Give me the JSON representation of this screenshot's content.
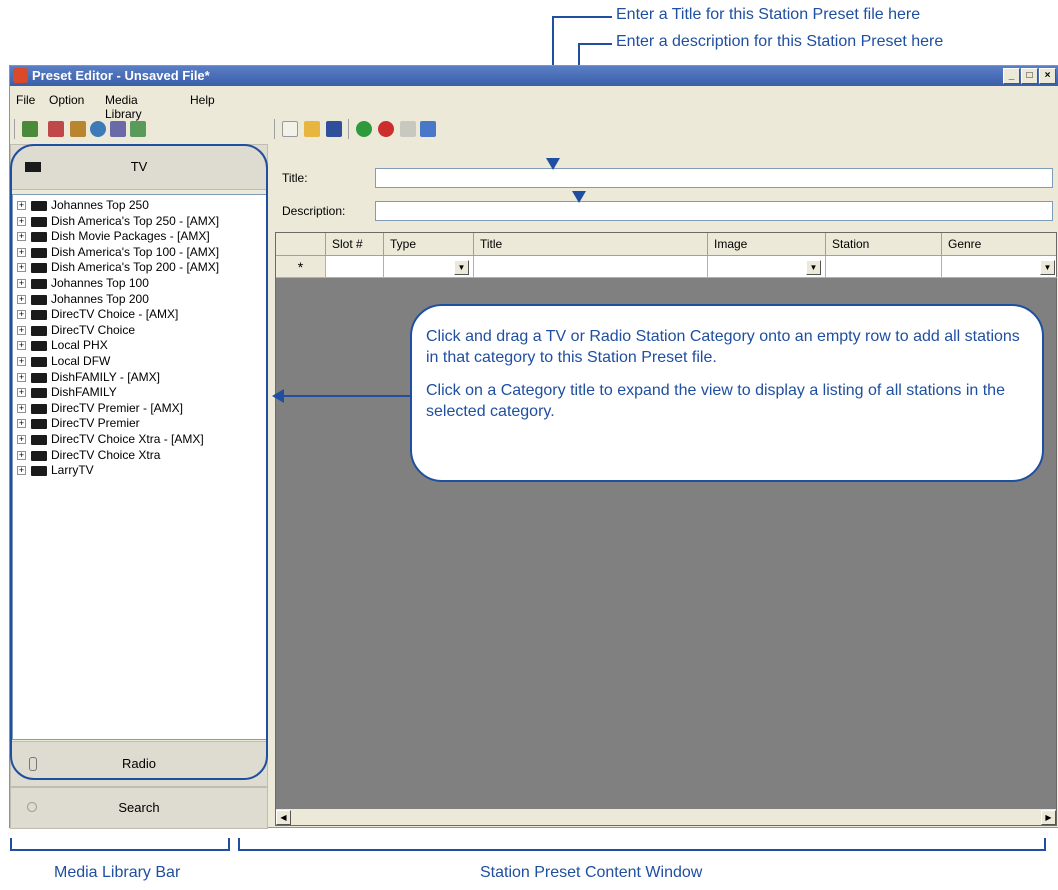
{
  "annotations": {
    "title_note": "Enter a Title for this Station Preset file here",
    "description_note": "Enter a description for this Station Preset here",
    "callout_p1": "Click and drag a TV or Radio Station Category onto an empty row to add all stations in that category to this Station Preset file.",
    "callout_p2": "Click on a Category title to expand the view to display a listing of all stations in the selected category.",
    "media_library_bar": "Media Library Bar",
    "content_window": "Station Preset Content Window"
  },
  "window": {
    "title": "Preset Editor - Unsaved File*",
    "controls": {
      "minimize": "_",
      "maximize": "□",
      "close": "×"
    }
  },
  "menu": [
    "File",
    "Option",
    "Media Library",
    "Help"
  ],
  "left_panel": {
    "tv_label": "TV",
    "radio_label": "Radio",
    "search_label": "Search",
    "categories": [
      "Johannes Top 250",
      "Dish America's Top 250 - [AMX]",
      "Dish Movie Packages - [AMX]",
      "Dish America's Top 100 - [AMX]",
      "Dish America's Top 200 - [AMX]",
      "Johannes Top 100",
      "Johannes Top 200",
      "DirecTV Choice - [AMX]",
      "DirecTV Choice",
      "Local PHX",
      "Local DFW",
      "DishFAMILY - [AMX]",
      "DishFAMILY",
      "DirecTV Premier - [AMX]",
      "DirecTV Premier",
      "DirecTV Choice Xtra - [AMX]",
      "DirecTV Choice Xtra",
      "LarryTV"
    ]
  },
  "form": {
    "title_label": "Title:",
    "title_value": "",
    "description_label": "Description:",
    "description_value": ""
  },
  "grid": {
    "columns": [
      "Slot #",
      "Type",
      "Title",
      "Image",
      "Station",
      "Genre"
    ],
    "new_row_marker": "*"
  },
  "colors": {
    "accent": "#1f4fa0",
    "grid_bg": "#808080",
    "chrome": "#ece9d8"
  }
}
